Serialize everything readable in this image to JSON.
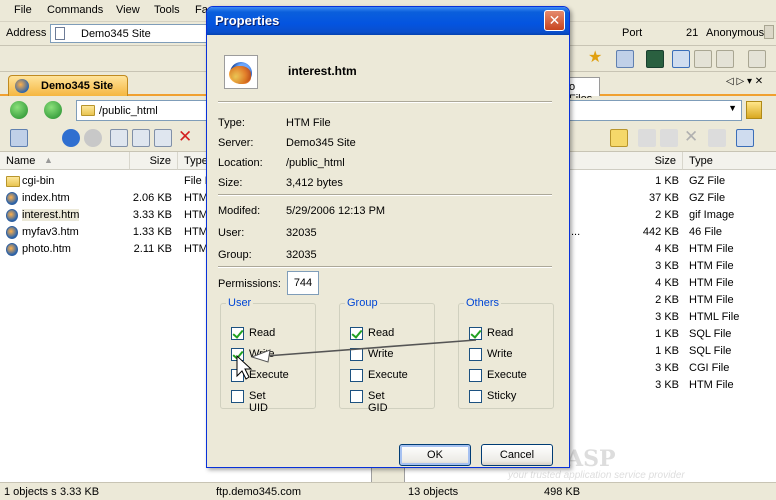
{
  "menu": {
    "items": [
      "File",
      "Commands",
      "View",
      "Tools",
      "Fa"
    ]
  },
  "address": {
    "label": "Address",
    "value": "Demo345 Site"
  },
  "connection": {
    "port_label": "Port",
    "port_value": "21",
    "user": "Anonymous"
  },
  "site_tab": {
    "label": "Demo345 Site"
  },
  "right_tab": {
    "label": "o Files"
  },
  "nav": {
    "path": "/public_html"
  },
  "left_panel": {
    "columns": [
      "Name",
      "Size",
      "Type"
    ],
    "rows": [
      {
        "name": "cgi-bin",
        "size": "",
        "type": "File F",
        "icon": "folder-icon"
      },
      {
        "name": "index.htm",
        "size": "2.06 KB",
        "type": "HTM",
        "icon": "htm-file-icon"
      },
      {
        "name": "interest.htm",
        "size": "3.33 KB",
        "type": "HTM",
        "icon": "htm-file-icon",
        "selected": true
      },
      {
        "name": "myfav3.htm",
        "size": "1.33 KB",
        "type": "HTM",
        "icon": "htm-file-icon"
      },
      {
        "name": "photo.htm",
        "size": "2.11 KB",
        "type": "HTM",
        "icon": "htm-file-icon"
      }
    ]
  },
  "right_panel": {
    "columns": [
      "Size",
      "Type"
    ],
    "rows": [
      {
        "name": "",
        "size": "1 KB",
        "type": "GZ File"
      },
      {
        "name": "",
        "size": "37 KB",
        "type": "GZ File"
      },
      {
        "name": "",
        "size": "2 KB",
        "type": "gif Image"
      },
      {
        "name": "...",
        "size": "442 KB",
        "type": "46 File"
      },
      {
        "name": "",
        "size": "4 KB",
        "type": "HTM File"
      },
      {
        "name": "",
        "size": "3 KB",
        "type": "HTM File"
      },
      {
        "name": "",
        "size": "4 KB",
        "type": "HTM File"
      },
      {
        "name": "",
        "size": "2 KB",
        "type": "HTM File"
      },
      {
        "name": "",
        "size": "3 KB",
        "type": "HTML File"
      },
      {
        "name": "",
        "size": "1 KB",
        "type": "SQL File"
      },
      {
        "name": "",
        "size": "1 KB",
        "type": "SQL File"
      },
      {
        "name": "",
        "size": "3 KB",
        "type": "CGI File"
      },
      {
        "name": "",
        "size": "3 KB",
        "type": "HTM File"
      }
    ]
  },
  "status": {
    "left_objects": "1 objects s",
    "left_size": "3.33 KB",
    "host": "ftp.demo345.com",
    "right_objects": "13 objects",
    "right_size": "498 KB"
  },
  "watermark": {
    "brand": "HostASP",
    "tagline": "your trusted application service provider"
  },
  "dialog": {
    "title": "Properties",
    "close_glyph": "✕",
    "filename": "interest.htm",
    "fields": [
      {
        "label": "Type:",
        "value": "HTM File"
      },
      {
        "label": "Server:",
        "value": "Demo345 Site"
      },
      {
        "label": "Location:",
        "value": "/public_html"
      },
      {
        "label": "Size:",
        "value": "3,412 bytes"
      },
      {
        "label": "Modifed:",
        "value": "5/29/2006 12:13 PM"
      },
      {
        "label": "User:",
        "value": "32035"
      },
      {
        "label": "Group:",
        "value": "32035"
      }
    ],
    "permissions_label": "Permissions:",
    "permissions_value": "744",
    "groups": [
      {
        "legend": "User",
        "options": [
          {
            "label": "Read",
            "checked": true
          },
          {
            "label": "Write",
            "checked": true
          },
          {
            "label": "Execute",
            "checked": false
          },
          {
            "label": "Set UID",
            "checked": false
          }
        ]
      },
      {
        "legend": "Group",
        "options": [
          {
            "label": "Read",
            "checked": true
          },
          {
            "label": "Write",
            "checked": false
          },
          {
            "label": "Execute",
            "checked": false
          },
          {
            "label": "Set GID",
            "checked": false
          }
        ]
      },
      {
        "legend": "Others",
        "options": [
          {
            "label": "Read",
            "checked": true
          },
          {
            "label": "Write",
            "checked": false
          },
          {
            "label": "Execute",
            "checked": false
          },
          {
            "label": "Sticky",
            "checked": false
          }
        ]
      }
    ],
    "ok_label": "OK",
    "cancel_label": "Cancel"
  },
  "colors": {
    "titlebar": "#0454e0",
    "legend": "#0046d5",
    "tab_accent": "#f0a030"
  }
}
